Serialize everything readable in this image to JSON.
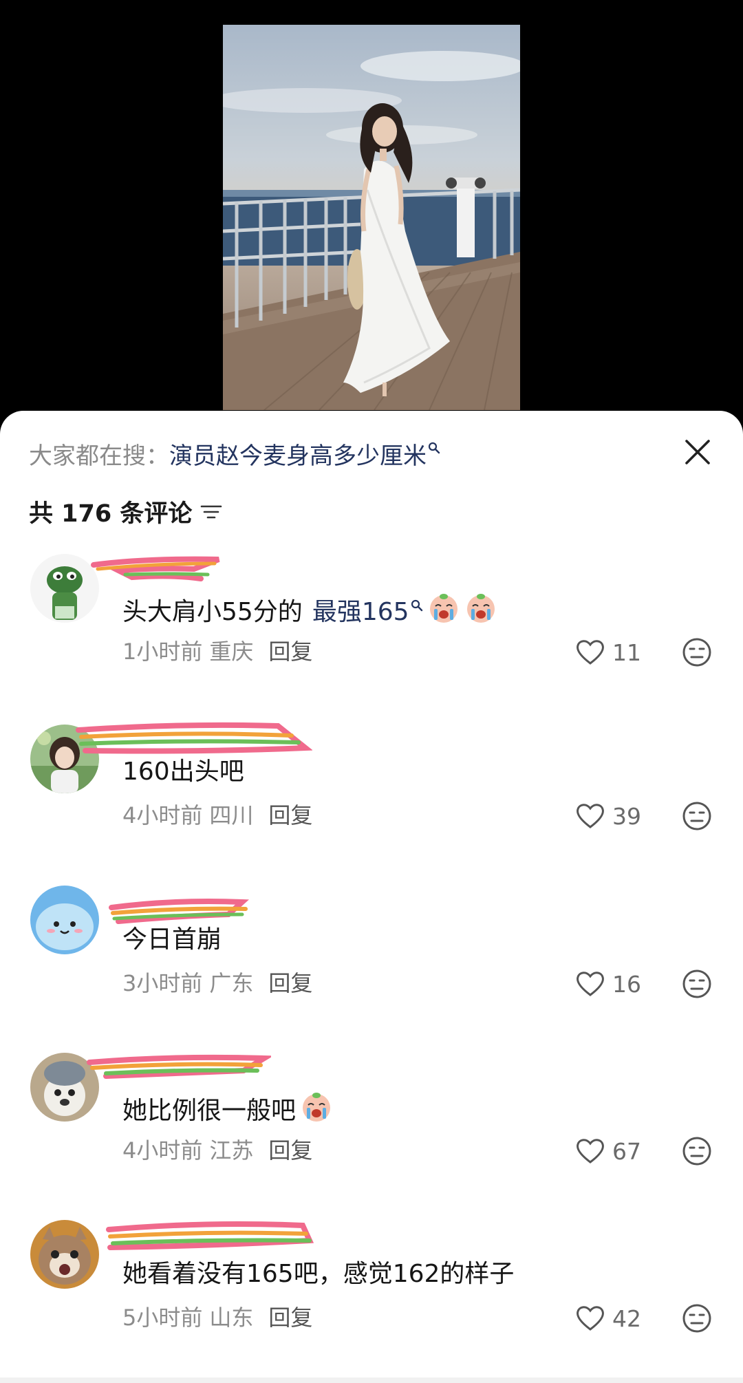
{
  "search_suggestion": {
    "prefix": "大家都在搜：",
    "query": "演员赵今麦身高多少厘米"
  },
  "comments_header": {
    "count_label": "共 176 条评论"
  },
  "comments": [
    {
      "text": "头大肩小55分的",
      "link_text": "最强165",
      "time": "1小时前",
      "location": "重庆",
      "reply_label": "回复",
      "likes": "11"
    },
    {
      "text": "160出头吧",
      "time": "4小时前",
      "location": "四川",
      "reply_label": "回复",
      "likes": "39"
    },
    {
      "text": "今日首崩",
      "time": "3小时前",
      "location": "广东",
      "reply_label": "回复",
      "likes": "16"
    },
    {
      "text": "她比例很一般吧",
      "time": "4小时前",
      "location": "江苏",
      "reply_label": "回复",
      "likes": "67"
    },
    {
      "text": "她看着没有165吧，感觉162的样子",
      "time": "5小时前",
      "location": "山东",
      "reply_label": "回复",
      "likes": "42"
    }
  ],
  "icons": {
    "close": "close-icon",
    "sort": "sort-icon",
    "search_link": "search-small-icon",
    "like": "heart-icon",
    "dislike": "meh-face-icon",
    "emoji": "crying-emoji-icon"
  },
  "colors": {
    "link": "#23345f",
    "muted": "#8c8c8c",
    "text": "#161616"
  }
}
